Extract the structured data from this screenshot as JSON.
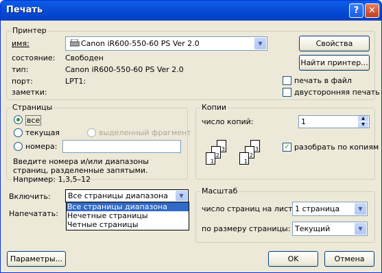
{
  "window": {
    "title": "Печать",
    "help": "?",
    "close": "✕"
  },
  "printer": {
    "legend": "Принтер",
    "name_label": "имя:",
    "name_value": "Canon iR600-550-60 PS Ver 2.0",
    "status_label": "состояние:",
    "status_value": "Свободен",
    "type_label": "тип:",
    "type_value": "Canon iR600-550-60 PS Ver 2.0",
    "port_label": "порт:",
    "port_value": "LPT1:",
    "notes_label": "заметки:",
    "properties_button": "Свойства",
    "find_printer_button": "Найти принтер...",
    "print_to_file_label": "печать в файл",
    "print_to_file_checked": false,
    "duplex_label": "двусторонняя печать",
    "duplex_checked": false
  },
  "pages": {
    "legend": "Страницы",
    "all_label": "все",
    "current_label": "текущая",
    "selection_label": "выделенный фрагмент",
    "numbers_label": "номера:",
    "numbers_value": "",
    "hint": "Введите номера и/или диапазоны страниц, разделенные запятыми. Например: 1,3,5–12",
    "selected": "all"
  },
  "copies": {
    "legend": "Копии",
    "count_label": "число копий:",
    "count_value": "1",
    "collate_label": "разобрать по копиям",
    "collate_checked": true
  },
  "include": {
    "label": "Включить:",
    "value": "Все страницы диапазона",
    "options": [
      "Все страницы диапазона",
      "Нечетные страницы",
      "Четные страницы"
    ],
    "selected_index": 0
  },
  "print_what": {
    "label": "Напечатать:"
  },
  "scale": {
    "legend": "Масштаб",
    "pages_per_sheet_label": "число страниц на листе:",
    "pages_per_sheet_value": "1 страница",
    "fit_to_label": "по размеру страницы:",
    "fit_to_value": "Текущий"
  },
  "footer": {
    "options_button": "Параметры...",
    "ok_button": "OK",
    "cancel_button": "Отмена"
  },
  "icons": {
    "printer": "printer-icon",
    "dropdown": "▼",
    "spin_up": "▲",
    "spin_down": "▼",
    "check": "✓"
  }
}
